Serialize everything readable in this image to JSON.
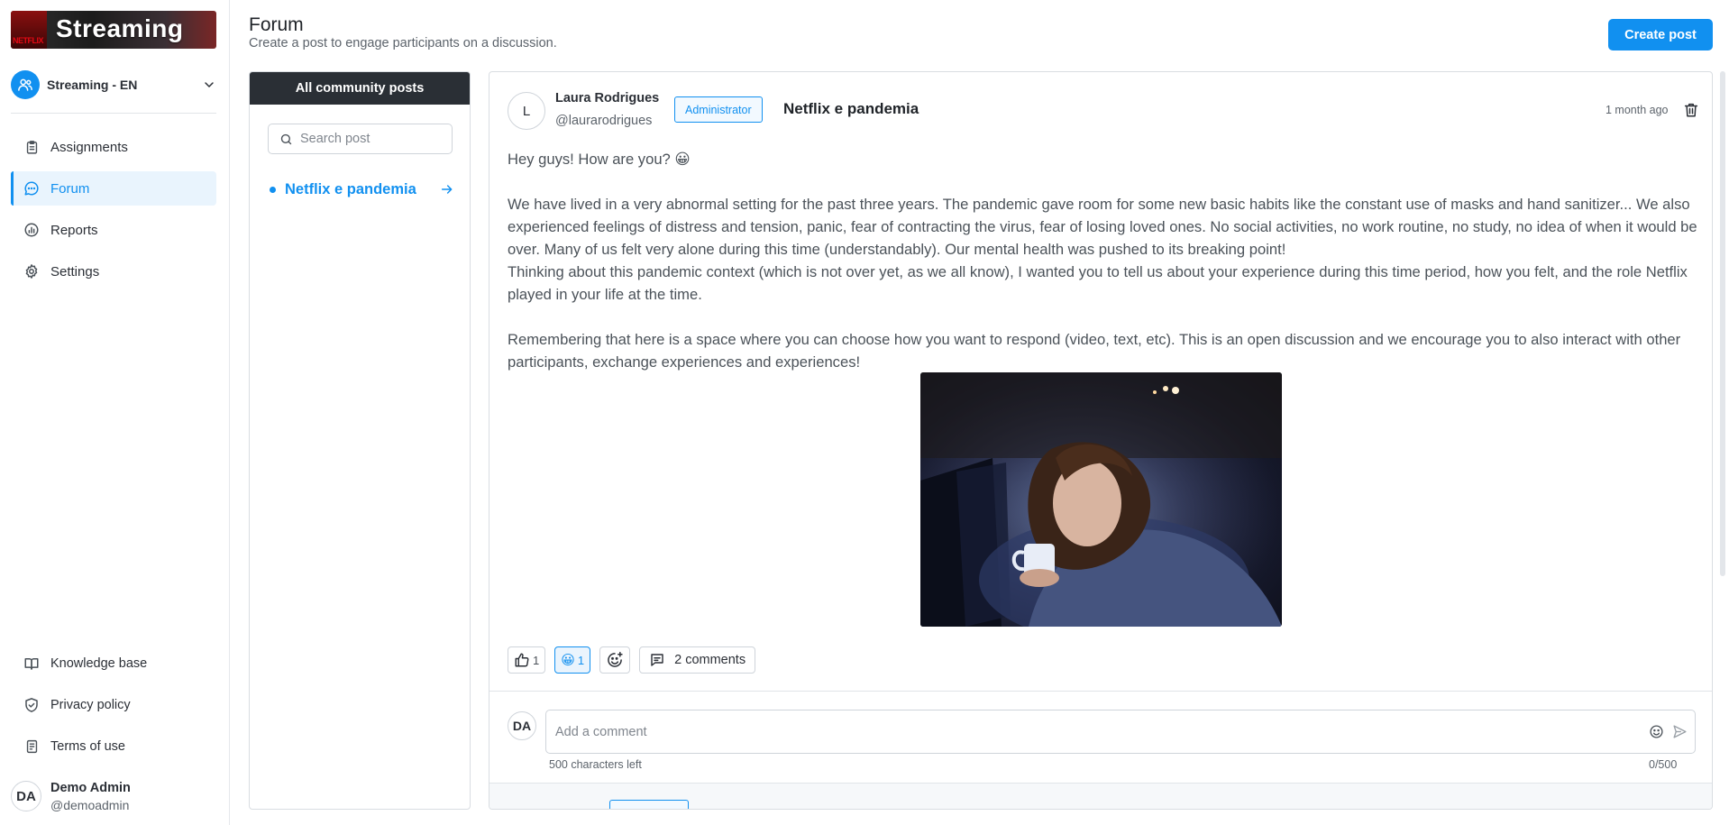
{
  "brand": {
    "title": "Streaming",
    "logo_text": "NETFLIX"
  },
  "workspace": {
    "name": "Streaming - EN"
  },
  "nav": {
    "items": [
      {
        "label": "Assignments"
      },
      {
        "label": "Forum"
      },
      {
        "label": "Reports"
      },
      {
        "label": "Settings"
      }
    ],
    "bottom": [
      {
        "label": "Knowledge base"
      },
      {
        "label": "Privacy policy"
      },
      {
        "label": "Terms of use"
      }
    ]
  },
  "user": {
    "initials": "DA",
    "name": "Demo Admin",
    "handle": "@demoadmin"
  },
  "header": {
    "title": "Forum",
    "subtitle": "Create a post to engage participants on a discussion.",
    "create_label": "Create post"
  },
  "posts_panel": {
    "heading": "All community posts",
    "search_placeholder": "Search post",
    "posts": [
      {
        "title": "Netflix e pandemia"
      }
    ]
  },
  "post": {
    "author_initial": "L",
    "author_name": "Laura Rodrigues",
    "author_handle": "@laurarodrigues",
    "role": "Administrator",
    "title": "Netflix e pandemia",
    "time": "1 month ago",
    "body": {
      "p1": "Hey guys! How are you? 😀",
      "p2": "We have lived in a very abnormal setting for the past three years. The pandemic gave room for some new basic habits like the constant use of masks and hand sanitizer... We also experienced feelings of distress and tension, panic, fear of contracting the virus, fear of losing loved ones. No social activities, no work routine, no study, no idea of when it would be over. Many of us felt very alone during this time (understandably). Our mental health was pushed to its breaking point!",
      "p3": "Thinking about this pandemic context (which is not over yet, as we all know), I wanted you to tell us about your experience during this time period, how you felt, and the role Netflix played in your life at the time.",
      "p4": "Remembering that here is a space where you can choose how you want to respond (video, text, etc). This is an open discussion and we encourage you to also interact with other participants, exchange experiences and experiences!"
    },
    "reactions": {
      "like_count": "1",
      "smile_emoji": "😀",
      "smile_count": "1",
      "comments_label": "2 comments"
    },
    "comment": {
      "user_initials": "DA",
      "placeholder": "Add a comment",
      "chars_left": "500 characters left",
      "count": "0/500"
    }
  },
  "colors": {
    "accent": "#1190f0",
    "dark_header": "#2a2f35",
    "active_bg": "#e9f4fd"
  }
}
